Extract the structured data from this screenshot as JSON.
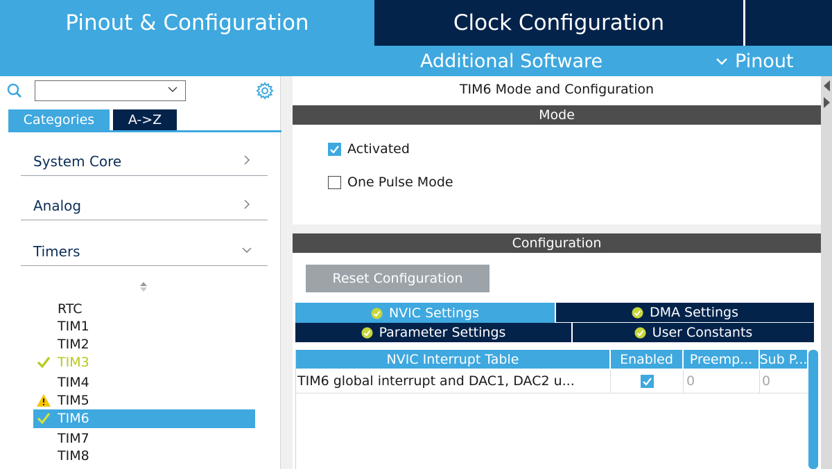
{
  "top_tabs": {
    "pinout": "Pinout & Configuration",
    "clock": "Clock Configuration",
    "extra": ""
  },
  "second_bar": {
    "additional_software": "Additional Software",
    "pinout_menu": "Pinout"
  },
  "sidebar": {
    "search": {
      "value": "",
      "placeholder": ""
    },
    "view_tabs": {
      "categories": "Categories",
      "az": "A->Z"
    },
    "categories": [
      {
        "label": "System Core",
        "icon": "chevron-right-icon"
      },
      {
        "label": "Analog",
        "icon": "chevron-right-icon"
      },
      {
        "label": "Timers",
        "icon": "chevron-down-icon"
      }
    ],
    "timers": [
      {
        "label": "RTC",
        "status": "none"
      },
      {
        "label": "TIM1",
        "status": "none"
      },
      {
        "label": "TIM2",
        "status": "none"
      },
      {
        "label": "TIM3",
        "status": "ok"
      },
      {
        "label": "TIM4",
        "status": "none"
      },
      {
        "label": "TIM5",
        "status": "warning"
      },
      {
        "label": "TIM6",
        "status": "ok",
        "selected": true
      },
      {
        "label": "TIM7",
        "status": "none"
      },
      {
        "label": "TIM8",
        "status": "none"
      }
    ]
  },
  "main": {
    "title": "TIM6 Mode and Configuration",
    "mode_header": "Mode",
    "mode_options": [
      {
        "label": "Activated",
        "checked": true
      },
      {
        "label": "One Pulse Mode",
        "checked": false
      }
    ],
    "config_header": "Configuration",
    "reset_button": "Reset Configuration",
    "config_tabs": {
      "nvic": "NVIC Settings",
      "dma": "DMA Settings",
      "param": "Parameter Settings",
      "user": "User Constants"
    },
    "nvic_table": {
      "headers": [
        "NVIC Interrupt Table",
        "Enabled",
        "Preemp...",
        "Sub P..."
      ],
      "rows": [
        {
          "name": "TIM6 global interrupt and DAC1, DAC2 u...",
          "enabled": true,
          "preemption": "0",
          "sub_priority": "0"
        }
      ]
    }
  },
  "colors": {
    "accent_blue": "#3ea8df",
    "navy": "#03234b",
    "section_gray": "#4d4d4d",
    "ok_green": "#b6c91a",
    "warning_yellow": "#f5c400"
  }
}
